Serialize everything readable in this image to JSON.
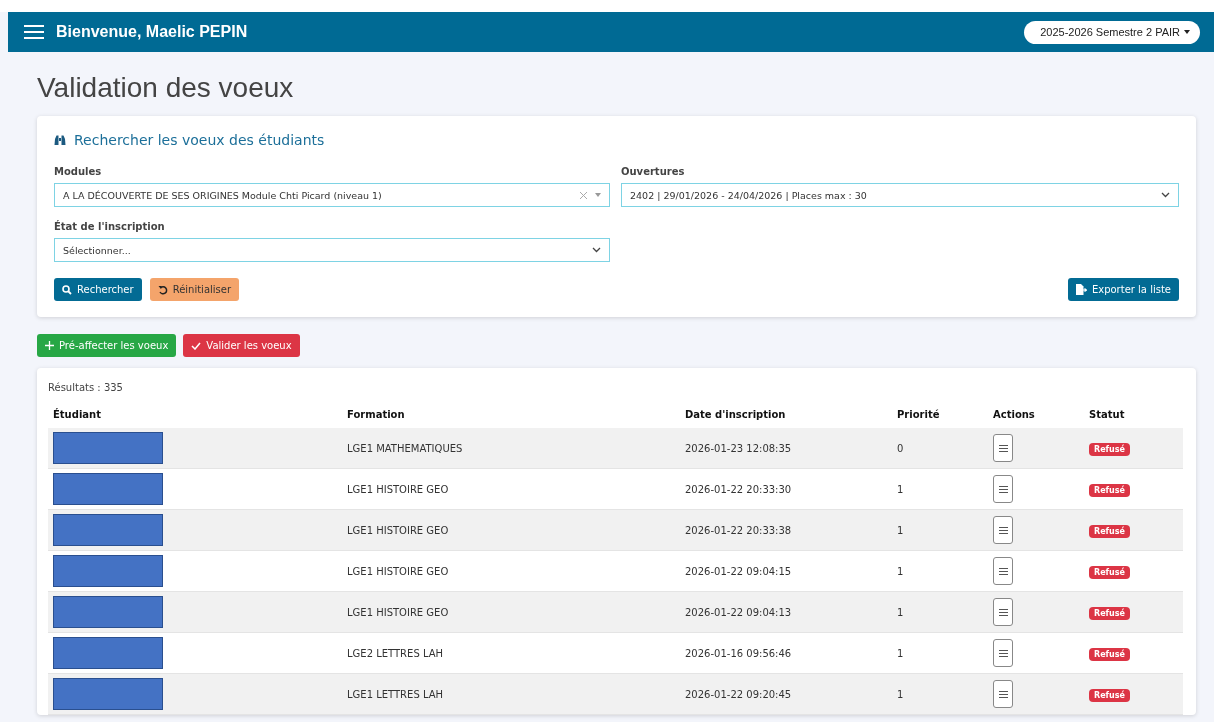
{
  "navbar": {
    "title": "Bienvenue, Maelic PEPIN",
    "semester": "2025-2026 Semestre 2 PAIR"
  },
  "page_title": "Validation des voeux",
  "search": {
    "title": "Rechercher les voeux des étudiants",
    "fields": [
      {
        "label": "Modules",
        "value": "A LA DÉCOUVERTE DE SES ORIGINES Module Chti Picard (niveau 1)",
        "clearable": true
      },
      {
        "label": "Ouvertures",
        "value": "2402 | 29/01/2026 - 24/04/2026 | Places max : 30",
        "clearable": false
      },
      {
        "label": "État de l'inscription",
        "placeholder": "Sélectionner...",
        "clearable": false
      }
    ],
    "buttons": [
      {
        "label": "Rechercher",
        "kind": "search"
      },
      {
        "label": "Réinitialiser",
        "kind": "reset"
      }
    ],
    "export": "Exporter la liste"
  },
  "actions": [
    {
      "label": "Pré-affecter les voeux",
      "kind": "add"
    },
    {
      "label": "Valider les voeux",
      "kind": "validate"
    }
  ],
  "results": {
    "count": "Résultats : 335",
    "columns": [
      "Étudiant",
      "Formation",
      "Date d'inscription",
      "Priorité",
      "Actions",
      "Statut"
    ],
    "rows": [
      {
        "formation": "LGE1 MATHEMATIQUES",
        "date": "2026-01-23 12:08:35",
        "priority": "0",
        "status": "Refusé"
      },
      {
        "formation": "LGE1 HISTOIRE GEO",
        "date": "2026-01-22 20:33:30",
        "priority": "1",
        "status": "Refusé"
      },
      {
        "formation": "LGE1 HISTOIRE GEO",
        "date": "2026-01-22 20:33:38",
        "priority": "1",
        "status": "Refusé"
      },
      {
        "formation": "LGE1 HISTOIRE GEO",
        "date": "2026-01-22 09:04:15",
        "priority": "1",
        "status": "Refusé"
      },
      {
        "formation": "LGE1 HISTOIRE GEO",
        "date": "2026-01-22 09:04:13",
        "priority": "1",
        "status": "Refusé"
      },
      {
        "formation": "LGE2 LETTRES LAH",
        "date": "2026-01-16 09:56:46",
        "priority": "1",
        "status": "Refusé"
      },
      {
        "formation": "LGE1 LETTRES LAH",
        "date": "2026-01-22 09:20:45",
        "priority": "1",
        "status": "Refusé"
      }
    ]
  }
}
